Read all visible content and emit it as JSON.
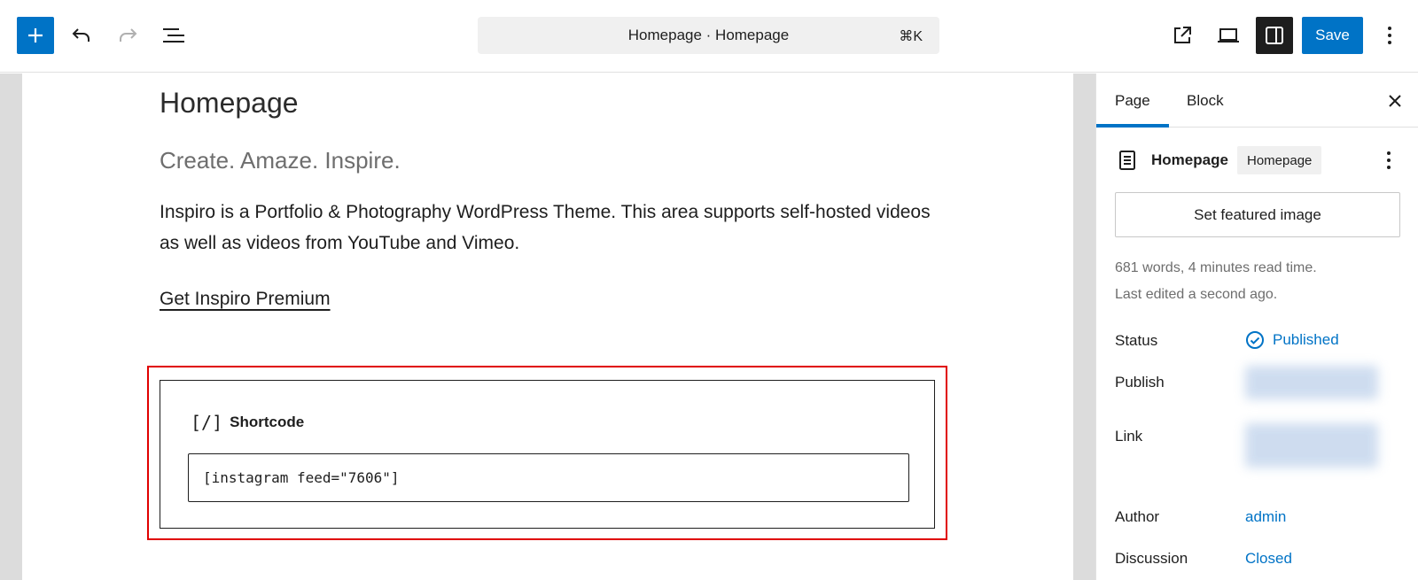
{
  "toolbar": {
    "command_title": "Homepage · Homepage",
    "command_shortcut": "⌘K",
    "save_label": "Save"
  },
  "editor": {
    "page_title": "Homepage",
    "tagline": "Create. Amaze. Inspire.",
    "description": "Inspiro is a Portfolio & Photography WordPress Theme. This area supports self-hosted videos as well as videos from YouTube and Vimeo.",
    "premium_link": "Get Inspiro Premium",
    "shortcode": {
      "icon_glyph": "[/]",
      "label": "Shortcode",
      "value": "[instagram feed=\"7606\"]"
    }
  },
  "sidebar": {
    "tabs": [
      {
        "label": "Page",
        "active": true
      },
      {
        "label": "Block",
        "active": false
      }
    ],
    "document": {
      "title": "Homepage",
      "template_badge": "Homepage"
    },
    "featured_image_label": "Set featured image",
    "word_count": "681 words, 4 minutes read time.",
    "last_edited": "Last edited a second ago.",
    "rows": {
      "status": {
        "label": "Status",
        "value": "Published"
      },
      "publish": {
        "label": "Publish"
      },
      "link": {
        "label": "Link"
      },
      "author": {
        "label": "Author",
        "value": "admin"
      },
      "discussion": {
        "label": "Discussion",
        "value": "Closed"
      }
    }
  },
  "colors": {
    "accent": "#0073c6",
    "highlight": "#e00000"
  }
}
